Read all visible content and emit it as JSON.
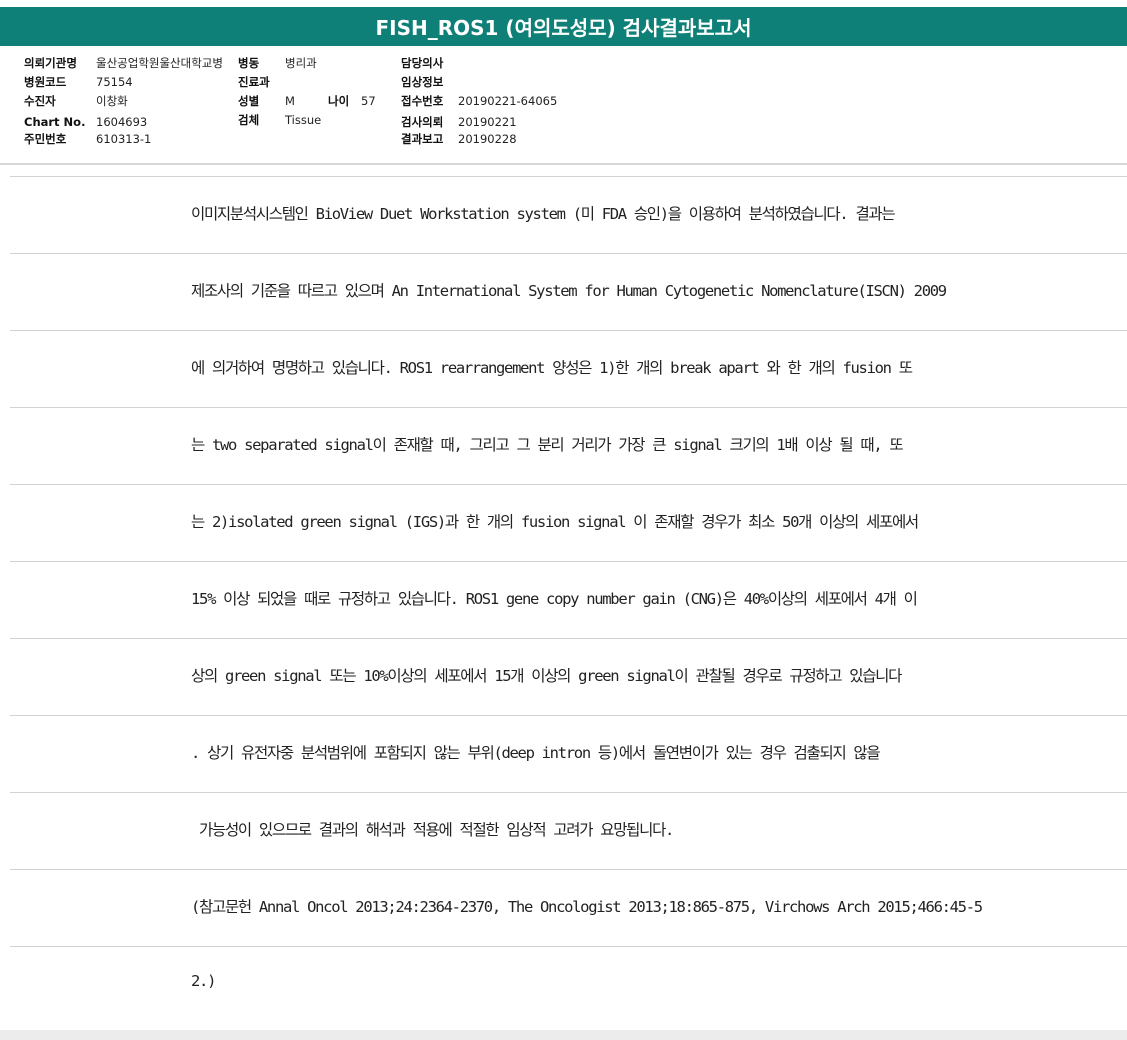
{
  "report": {
    "title": "FISH_ROS1 (여의도성모) 검사결과보고서"
  },
  "patient_info": {
    "institution_label": "의뢰기관명",
    "institution_value": "울산공업학원울산대학교병",
    "ward_label": "병동",
    "ward_value": "병리과",
    "doctor_label": "담당의사",
    "doctor_value": "",
    "hospital_code_label": "병원코드",
    "hospital_code_value": "75154",
    "department_label": "진료과",
    "department_value": "",
    "clinical_info_label": "임상정보",
    "clinical_info_value": "",
    "examinee_label": "수진자",
    "examinee_value": "이창화",
    "sex_label": "성별",
    "sex_value": "M",
    "age_label": "나이",
    "age_value": "57",
    "receipt_no_label": "접수번호",
    "receipt_no_value": "20190221-64065",
    "chart_no_label": "Chart No.",
    "chart_no_value": "1604693",
    "specimen_label": "검체",
    "specimen_value": "Tissue",
    "request_date_label": "검사의뢰",
    "request_date_value": "20190221",
    "resident_no_label": "주민번호",
    "resident_no_value": "610313-1",
    "report_date_label": "결과보고",
    "report_date_value": "20190228"
  },
  "body_lines": [
    "이미지분석시스템인 BioView Duet Workstation system (미 FDA 승인)을 이용하여 분석하였습니다. 결과는",
    "제조사의 기준을 따르고 있으며 An International System for Human Cytogenetic Nomenclature(ISCN) 2009",
    "에 의거하여 명명하고 있습니다. ROS1 rearrangement 양성은 1)한 개의 break apart 와 한 개의 fusion 또",
    "는 two separated signal이 존재할 때, 그리고 그 분리 거리가 가장 큰 signal 크기의 1배 이상 될 때, 또",
    "는 2)isolated green signal (IGS)과 한 개의 fusion signal 이 존재할 경우가 최소 50개 이상의 세포에서",
    "15% 이상 되었을 때로 규정하고 있습니다. ROS1 gene copy number gain (CNG)은 40%이상의 세포에서 4개 이",
    "상의 green signal 또는 10%이상의 세포에서 15개 이상의 green signal이 관찰될 경우로 규정하고 있습니다",
    ". 상기 유전자중 분석범위에 포함되지 않는 부위(deep intron 등)에서 돌연변이가 있는 경우 검출되지 않을",
    " 가능성이 있으므로 결과의 해석과 적용에 적절한 임상적 고려가 요망됩니다.",
    "(참고문헌 Annal Oncol 2013;24:2364-2370, The Oncologist 2013;18:865-875, Virchows Arch 2015;466:45-5",
    "2.)"
  ],
  "colors": {
    "title_bar": "#0e8078",
    "title_text": "#ffffff"
  }
}
